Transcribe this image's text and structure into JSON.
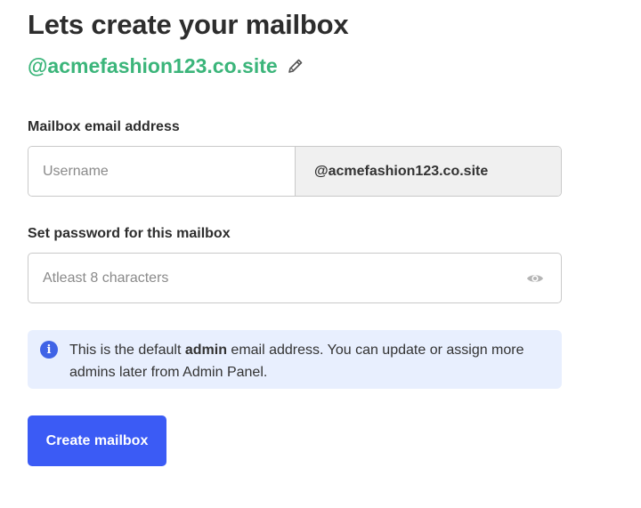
{
  "header": {
    "title": "Lets create your mailbox",
    "domain": "@acmefashion123.co.site"
  },
  "email": {
    "label": "Mailbox email address",
    "placeholder": "Username",
    "value": "",
    "suffix": "@acmefashion123.co.site"
  },
  "password": {
    "label": "Set password for this mailbox",
    "placeholder": "Atleast 8 characters",
    "value": ""
  },
  "info": {
    "text_before": "This is the default ",
    "text_bold": "admin",
    "text_after": " email address. You can update or assign more admins later from Admin Panel."
  },
  "actions": {
    "create_label": "Create mailbox"
  },
  "icons": {
    "edit": "pencil-icon",
    "visibility": "eye-icon",
    "info": "info-icon"
  },
  "colors": {
    "accent": "#3b5bf5",
    "domain": "#3bb57a",
    "info_bg": "#e8effe"
  }
}
